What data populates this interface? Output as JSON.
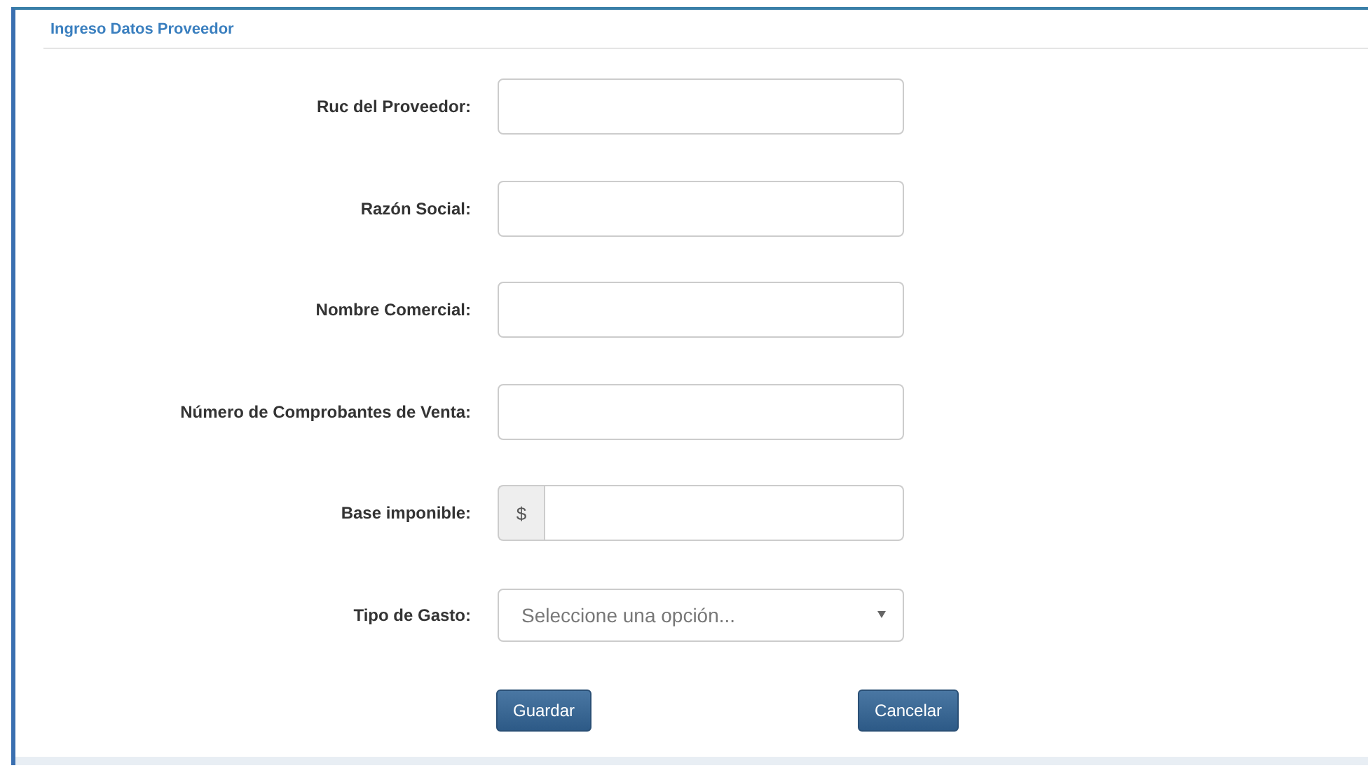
{
  "panel": {
    "title": "Ingreso Datos Proveedor"
  },
  "fields": [
    {
      "label": "Ruc del Proveedor:",
      "kind": "text"
    },
    {
      "label": "Razón Social:",
      "kind": "text"
    },
    {
      "label": "Nombre Comercial:",
      "kind": "text"
    },
    {
      "label": "Número de Comprobantes de Venta:",
      "kind": "text"
    },
    {
      "label": "Base imponible:",
      "kind": "addon",
      "addon": "$"
    },
    {
      "label": "Tipo de Gasto:",
      "kind": "select",
      "placeholder": "Seleccione una opción..."
    }
  ],
  "buttons": [
    "Guardar",
    "Cancelar"
  ]
}
